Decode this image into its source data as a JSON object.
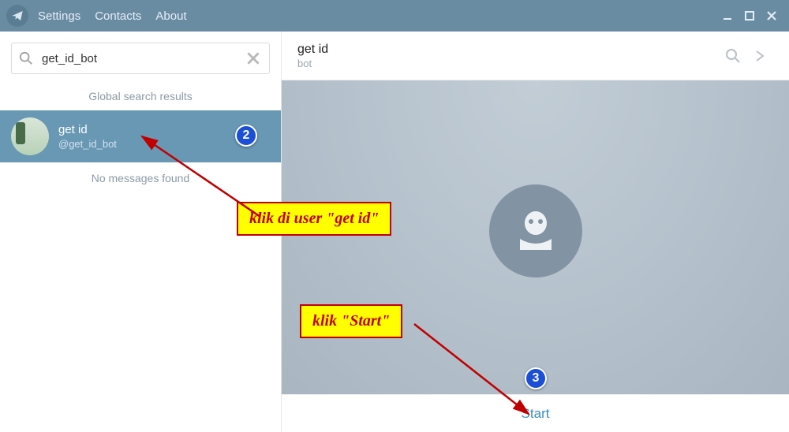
{
  "titlebar": {
    "menu": [
      "Settings",
      "Contacts",
      "About"
    ]
  },
  "sidebar": {
    "search_value": "get_id_bot",
    "global_label": "Global search results",
    "result": {
      "name": "get id",
      "handle": "@get_id_bot"
    },
    "no_messages": "No messages found"
  },
  "header": {
    "title": "get id",
    "subtitle": "bot"
  },
  "footer": {
    "start": "Start"
  },
  "badges": {
    "two": "2",
    "three": "3"
  },
  "callouts": {
    "user": "klik di user \"get id\"",
    "start": "klik \"Start\""
  }
}
